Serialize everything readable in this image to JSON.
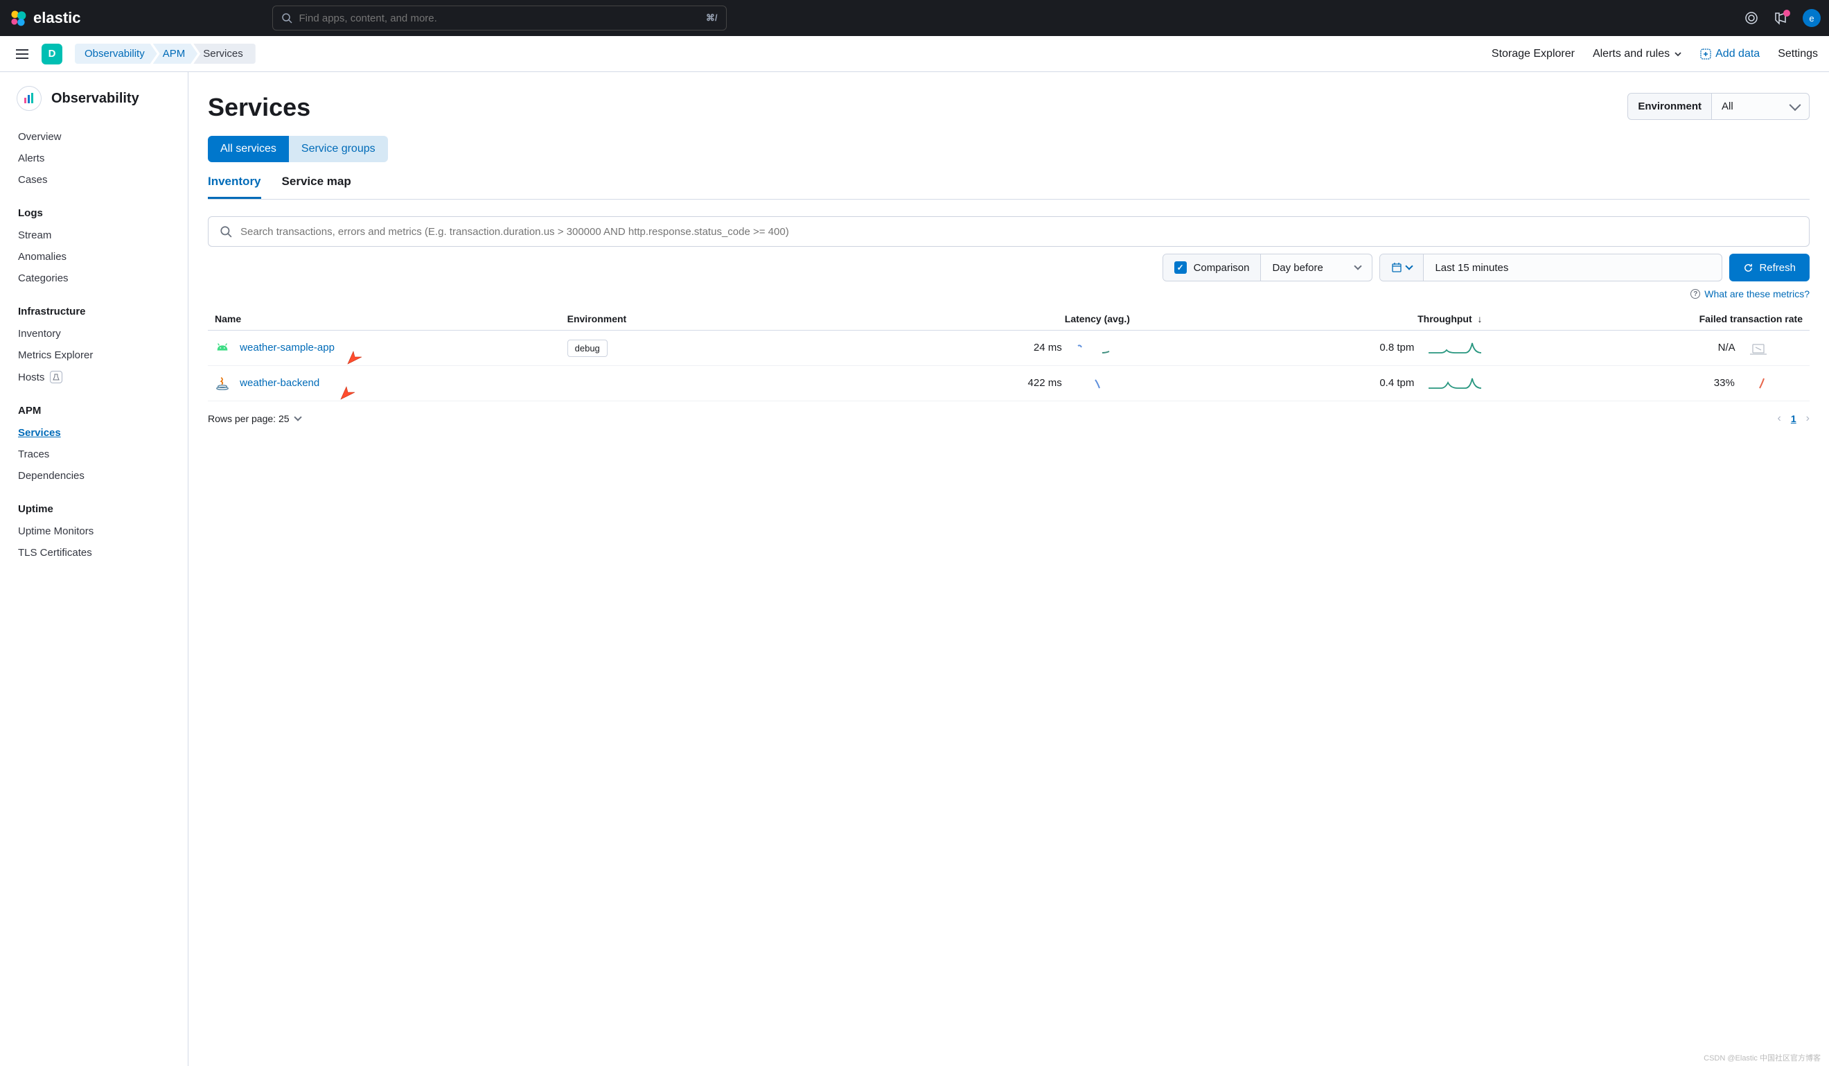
{
  "header": {
    "brand": "elastic",
    "search_placeholder": "Find apps, content, and more.",
    "shortcut": "⌘/",
    "avatar_letter": "e"
  },
  "subheader": {
    "space_letter": "D",
    "breadcrumbs": [
      "Observability",
      "APM",
      "Services"
    ],
    "right": {
      "storage_explorer": "Storage Explorer",
      "alerts_rules": "Alerts and rules",
      "add_data": "Add data",
      "settings": "Settings"
    }
  },
  "sidebar": {
    "title": "Observability",
    "groups": [
      {
        "title": "",
        "items": [
          "Overview",
          "Alerts",
          "Cases"
        ]
      },
      {
        "title": "Logs",
        "items": [
          "Stream",
          "Anomalies",
          "Categories"
        ]
      },
      {
        "title": "Infrastructure",
        "items": [
          "Inventory",
          "Metrics Explorer",
          "Hosts"
        ]
      },
      {
        "title": "APM",
        "items": [
          "Services",
          "Traces",
          "Dependencies"
        ]
      },
      {
        "title": "Uptime",
        "items": [
          "Uptime Monitors",
          "TLS Certificates"
        ]
      }
    ],
    "active_item": "Services",
    "beta_item": "Hosts"
  },
  "main": {
    "title": "Services",
    "env_label": "Environment",
    "env_value": "All",
    "toggle": {
      "active": "All services",
      "inactive": "Service groups"
    },
    "tabs": {
      "active": "Inventory",
      "other": "Service map"
    },
    "search_placeholder": "Search transactions, errors and metrics (E.g. transaction.duration.us > 300000 AND http.response.status_code >= 400)",
    "comparison_label": "Comparison",
    "comparison_value": "Day before",
    "time_range": "Last 15 minutes",
    "refresh_label": "Refresh",
    "metrics_hint": "What are these metrics?",
    "columns": {
      "name": "Name",
      "environment": "Environment",
      "latency": "Latency (avg.)",
      "throughput": "Throughput",
      "failed": "Failed transaction rate"
    },
    "rows": [
      {
        "name": "weather-sample-app",
        "icon": "android",
        "env": "debug",
        "latency": "24 ms",
        "throughput": "0.8 tpm",
        "failed": "N/A"
      },
      {
        "name": "weather-backend",
        "icon": "java",
        "env": "",
        "latency": "422 ms",
        "throughput": "0.4 tpm",
        "failed": "33%"
      }
    ],
    "rows_per_page": "Rows per page: 25",
    "current_page": "1"
  },
  "watermark": "CSDN @Elastic 中国社区官方博客"
}
